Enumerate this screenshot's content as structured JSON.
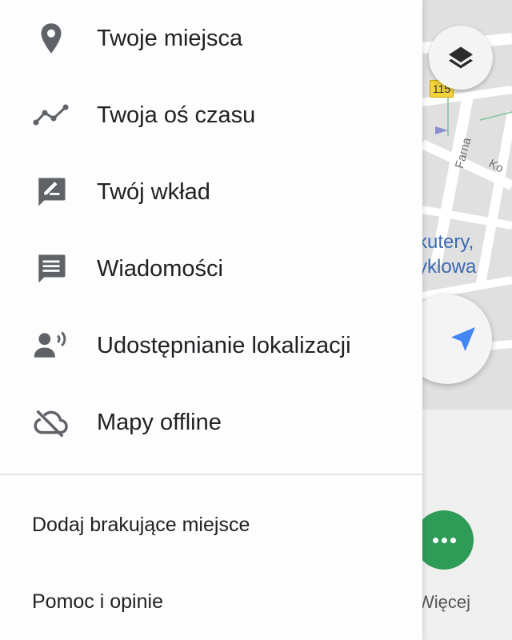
{
  "map": {
    "route_number": "115",
    "street_farna": "Farna",
    "street_ko": "Ko",
    "poi_line1": "kutery,",
    "poi_line2": "yklowa",
    "layers_icon": "layers-icon",
    "locate_icon": "navigation-arrow-icon",
    "more_label": "Więcej",
    "colors": {
      "poi": "#3d6bb3",
      "more_button": "#2e9c57",
      "locate_arrow": "#4285f4",
      "route_badge": "#f5d33b"
    }
  },
  "drawer": {
    "items": [
      {
        "label": "Twoje miejsca",
        "icon": "location-pin-icon"
      },
      {
        "label": "Twoja oś czasu",
        "icon": "timeline-icon"
      },
      {
        "label": "Twój wkład",
        "icon": "contribution-icon"
      },
      {
        "label": "Wiadomości",
        "icon": "message-icon"
      },
      {
        "label": "Udostępnianie lokalizacji",
        "icon": "location-sharing-icon"
      },
      {
        "label": "Mapy offline",
        "icon": "cloud-off-icon"
      }
    ],
    "secondary": [
      {
        "label": "Dodaj brakujące miejsce"
      },
      {
        "label": "Pomoc i opinie"
      }
    ]
  }
}
